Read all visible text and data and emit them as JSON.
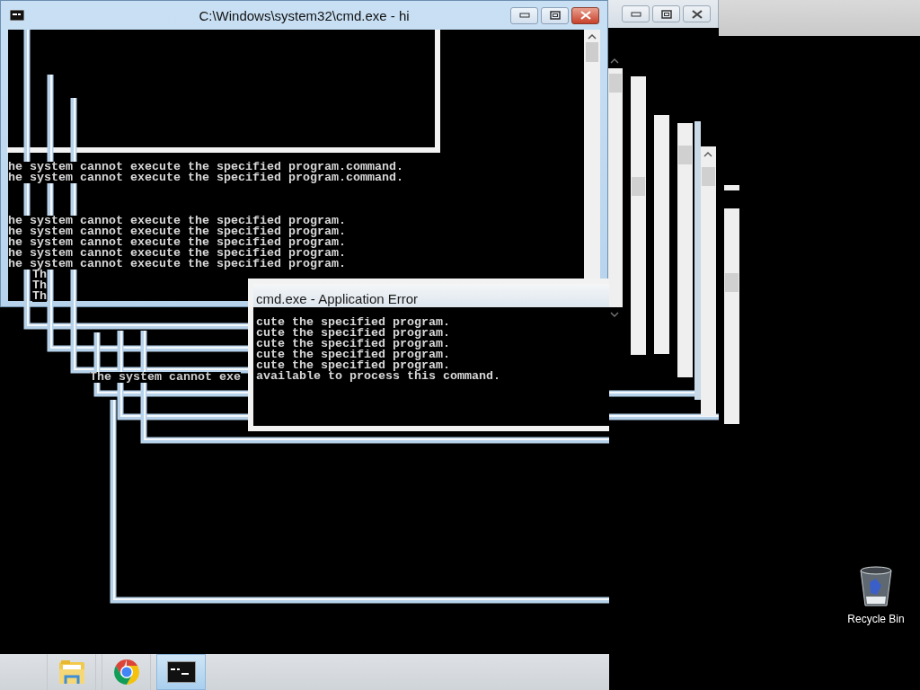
{
  "main_window": {
    "title": "C:\\Windows\\system32\\cmd.exe - hi",
    "console_blocks": [
      {
        "lines": [
          "he system cannot execute the specified program.command.",
          "he system cannot execute the specified program.command."
        ]
      },
      {
        "lines": [
          "he system cannot execute the specified program.",
          "he system cannot execute the specified program.",
          "he system cannot execute the specified program.",
          "he system cannot execute the specified program.",
          "he system cannot execute the specified program."
        ]
      }
    ],
    "console_fragments": [
      "Th",
      "Th",
      "Th"
    ]
  },
  "error_dialog": {
    "title": "cmd.exe - Application Error",
    "console_lines": [
      "cute the specified program.",
      "cute the specified program.",
      "cute the specified program.",
      "cute the specified program.",
      "cute the specified program.",
      "available to process this command."
    ]
  },
  "background_fragment": "The system cannot exe",
  "taskbar": {
    "items": [
      {
        "kind": "folder",
        "selected": false
      },
      {
        "kind": "browser",
        "selected": false
      },
      {
        "kind": "console",
        "selected": true
      }
    ]
  },
  "desktop_icons": [
    {
      "kind": "recycle-bin",
      "label": "Recycle Bin"
    }
  ]
}
